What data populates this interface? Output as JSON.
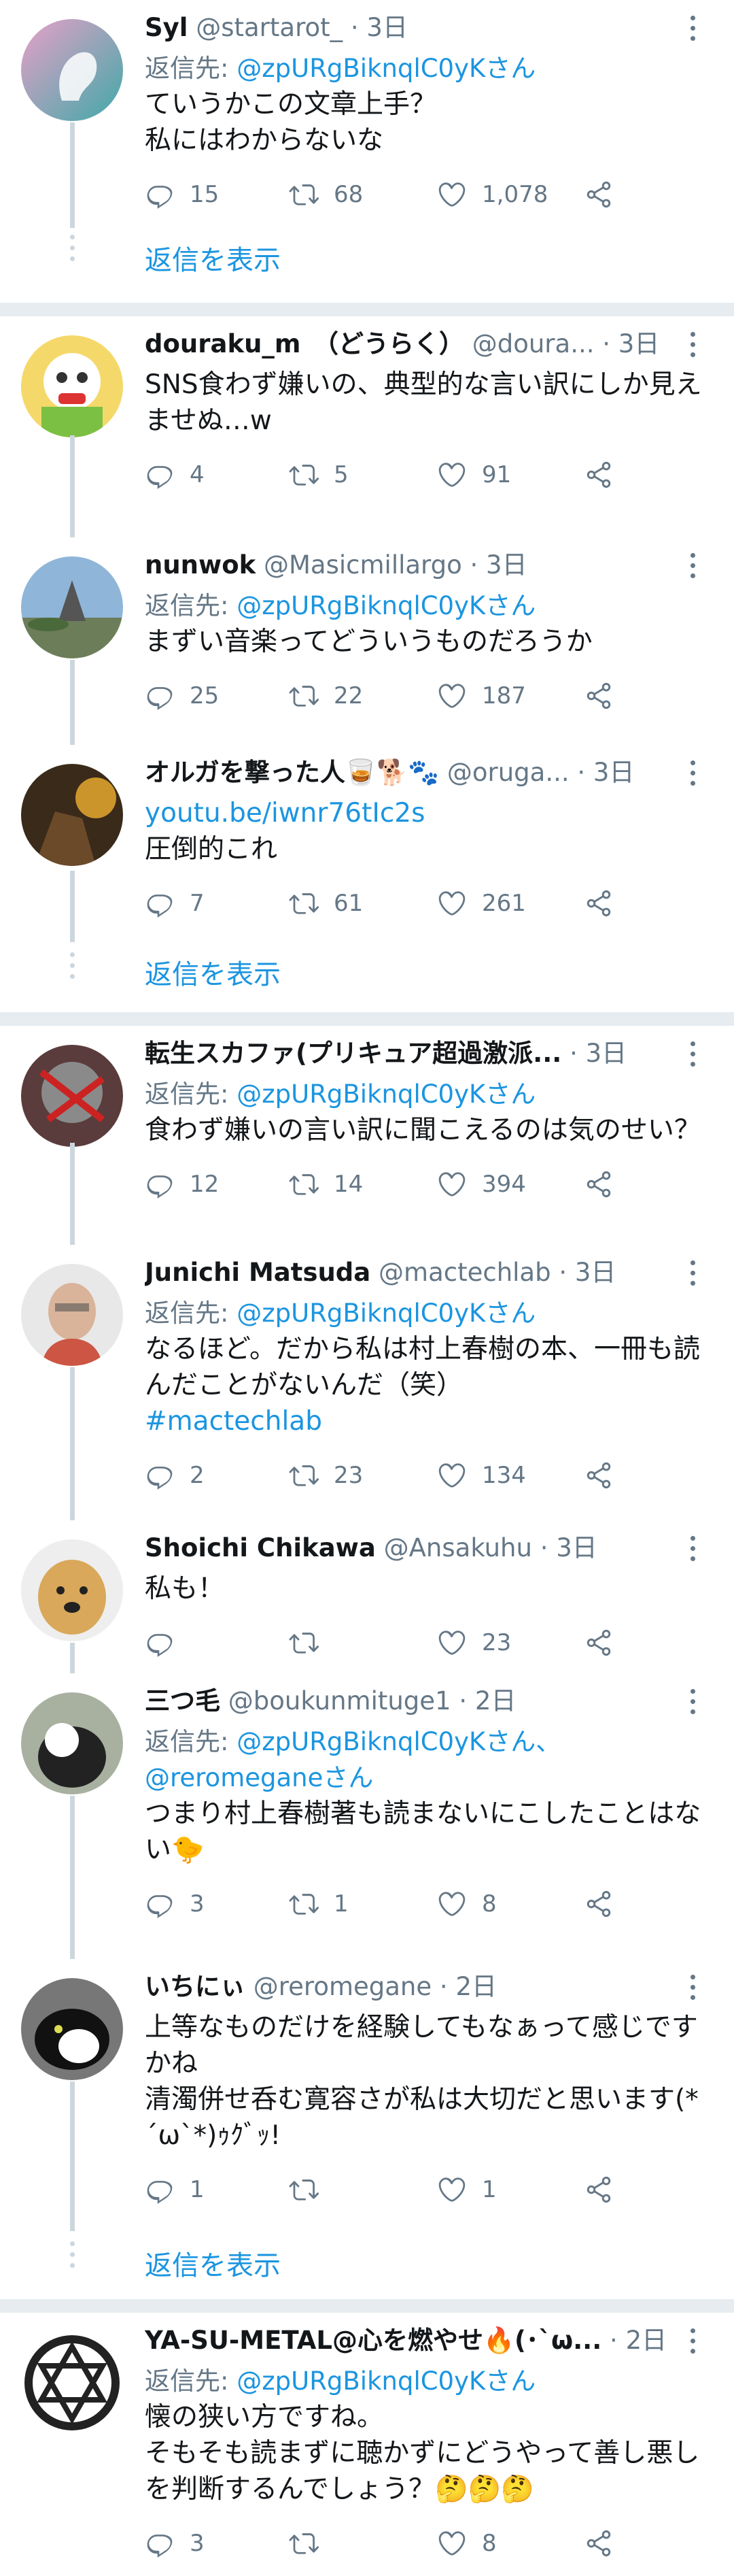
{
  "colors": {
    "accent": "#1b95e0",
    "muted": "#657786",
    "text": "#14171a",
    "line": "#ccd6dd",
    "divider": "#e6ecf0"
  },
  "icons": {
    "reply": "reply-icon",
    "retweet": "retweet-icon",
    "like": "heart-icon",
    "share": "share-icon",
    "more": "more-icon"
  },
  "tweets": [
    {
      "name": "Syl",
      "handle": "@startarot_",
      "sep": "·",
      "time": "3日",
      "reply_prefix": "返信先: ",
      "reply_to": "@zpURgBiknqlC0yKさん",
      "reply_to2": "",
      "text": "ていうかこの文章上手？\n私にはわからないな",
      "link": "",
      "hashtag": "",
      "counts": {
        "reply": "15",
        "retweet": "68",
        "like": "1,078"
      },
      "show_replies": "返信を表示"
    },
    {
      "name": "douraku_m　（どうらく）",
      "handle": "@doura...",
      "sep": "·",
      "time": "3日",
      "reply_prefix": "",
      "reply_to": "",
      "reply_to2": "",
      "text": "SNS食わず嫌いの、典型的な言い訳にしか見えませぬ…w",
      "link": "",
      "hashtag": "",
      "counts": {
        "reply": "4",
        "retweet": "5",
        "like": "91"
      },
      "show_replies": ""
    },
    {
      "name": "nunwok",
      "handle": "@Masicmillargo",
      "sep": "·",
      "time": "3日",
      "reply_prefix": "返信先: ",
      "reply_to": "@zpURgBiknqlC0yKさん",
      "reply_to2": "",
      "text": "まずい音楽ってどういうものだろうか",
      "link": "",
      "hashtag": "",
      "counts": {
        "reply": "25",
        "retweet": "22",
        "like": "187"
      },
      "show_replies": ""
    },
    {
      "name": "オルガを撃った人🥃🐕🐾",
      "handle": "@oruga...",
      "sep": "·",
      "time": "3日",
      "reply_prefix": "",
      "reply_to": "",
      "reply_to2": "",
      "text": "圧倒的これ",
      "link": "youtu.be/iwnr76tIc2s",
      "hashtag": "",
      "counts": {
        "reply": "7",
        "retweet": "61",
        "like": "261"
      },
      "show_replies": "返信を表示"
    },
    {
      "name": "転生スカファ(プリキュア超過激派...",
      "handle": "",
      "sep": "·",
      "time": "3日",
      "reply_prefix": "返信先: ",
      "reply_to": "@zpURgBiknqlC0yKさん",
      "reply_to2": "",
      "text": "食わず嫌いの言い訳に聞こえるのは気のせい？",
      "link": "",
      "hashtag": "",
      "counts": {
        "reply": "12",
        "retweet": "14",
        "like": "394"
      },
      "show_replies": ""
    },
    {
      "name": "Junichi Matsuda",
      "handle": "@mactechlab",
      "sep": "·",
      "time": "3日",
      "reply_prefix": "返信先: ",
      "reply_to": "@zpURgBiknqlC0yKさん",
      "reply_to2": "",
      "text": "なるほど。だから私は村上春樹の本、一冊も読んだことがないんだ（笑）",
      "link": "",
      "hashtag": "#mactechlab",
      "counts": {
        "reply": "2",
        "retweet": "23",
        "like": "134"
      },
      "show_replies": ""
    },
    {
      "name": "Shoichi Chikawa",
      "handle": "@Ansakuhu",
      "sep": "·",
      "time": "3日",
      "reply_prefix": "",
      "reply_to": "",
      "reply_to2": "",
      "text": "私も！",
      "link": "",
      "hashtag": "",
      "counts": {
        "reply": "",
        "retweet": "",
        "like": "23"
      },
      "show_replies": ""
    },
    {
      "name": "三つ毛",
      "handle": "@boukunmituge1",
      "sep": "·",
      "time": "2日",
      "reply_prefix": "返信先: ",
      "reply_to": "@zpURgBiknqlC0yKさん、",
      "reply_to2": "@reromeganeさん",
      "text": "つまり村上春樹著も読まないにこしたことはない🐤",
      "link": "",
      "hashtag": "",
      "counts": {
        "reply": "3",
        "retweet": "1",
        "like": "8"
      },
      "show_replies": ""
    },
    {
      "name": "いちにぃ",
      "handle": "@reromegane",
      "sep": "·",
      "time": "2日",
      "reply_prefix": "",
      "reply_to": "",
      "reply_to2": "",
      "text": "上等なものだけを経験してもなぁって感じですかね\n清濁併せ呑む寛容さが私は大切だと思います(*´ω`*)ｩｸﾞｯ!",
      "link": "",
      "hashtag": "",
      "counts": {
        "reply": "1",
        "retweet": "",
        "like": "1"
      },
      "show_replies": "返信を表示"
    },
    {
      "name": "YA-SU-METAL@心を燃やせ🔥(･`ω...",
      "handle": "",
      "sep": "·",
      "time": "2日",
      "reply_prefix": "返信先: ",
      "reply_to": "@zpURgBiknqlC0yKさん",
      "reply_to2": "",
      "text": "懐の狭い方ですね。\nそもそも読まずに聴かずにどうやって善し悪しを判断するんでしょう？🤔🤔🤔",
      "link": "",
      "hashtag": "",
      "counts": {
        "reply": "3",
        "retweet": "",
        "like": "8"
      },
      "show_replies": ""
    }
  ]
}
